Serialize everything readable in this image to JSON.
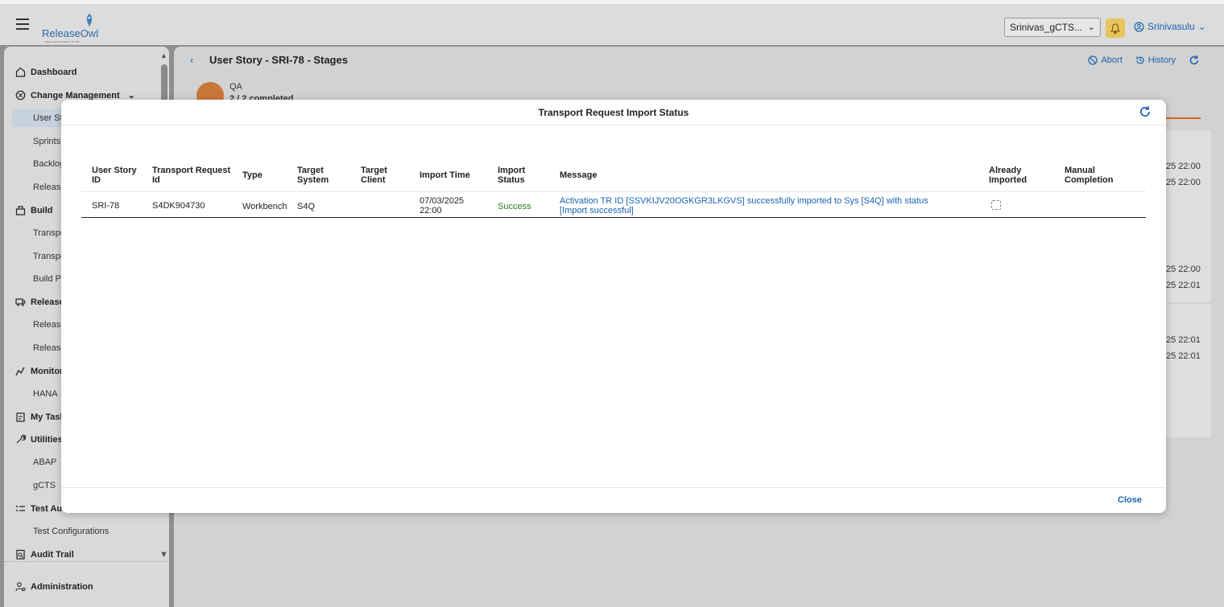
{
  "shell": {
    "logo_text": "ReleaseOwl",
    "logo_tagline": "Native DevOps Platform for SAP",
    "project": "Srinivas_gCTS...",
    "user": "Srinivasulu"
  },
  "sidebar": {
    "items": [
      {
        "label": "Dashboard",
        "icon": "home-icon"
      },
      {
        "label": "Change Management",
        "icon": "change-management-icon"
      },
      {
        "label": "User Stories"
      },
      {
        "label": "Sprints"
      },
      {
        "label": "Backlog"
      },
      {
        "label": "Releases"
      },
      {
        "label": "Build",
        "icon": "build-icon"
      },
      {
        "label": "Transports"
      },
      {
        "label": "Transports"
      },
      {
        "label": "Build Pipelines"
      },
      {
        "label": "Release",
        "icon": "release-icon"
      },
      {
        "label": "Release"
      },
      {
        "label": "Release"
      },
      {
        "label": "Monitoring",
        "icon": "monitor-icon"
      },
      {
        "label": "HANA"
      },
      {
        "label": "My Tasks",
        "icon": "tasks-icon"
      },
      {
        "label": "Utilities",
        "icon": "utilities-icon"
      },
      {
        "label": "ABAP"
      },
      {
        "label": "gCTS"
      },
      {
        "label": "Test Automation",
        "icon": "test-icon"
      },
      {
        "label": "Test Configurations"
      },
      {
        "label": "Audit Trail",
        "icon": "audit-icon"
      },
      {
        "label": "Administration",
        "icon": "admin-icon"
      }
    ]
  },
  "page": {
    "title": "User Story - SRI-78 - Stages",
    "abort_label": "Abort",
    "history_label": "History",
    "stage_name": "QA",
    "stage_sub": "2 / 2 completed",
    "times": [
      "25 22:00",
      "25 22:00",
      "25 22:00",
      "25 22:01",
      "25 22:01",
      "25 22:01"
    ]
  },
  "modal": {
    "title": "Transport Request Import Status",
    "close_label": "Close",
    "columns": [
      "User Story ID",
      "Transport Request Id",
      "Type",
      "Target System",
      "Target Client",
      "Import Time",
      "Import Status",
      "Message",
      "Already Imported",
      "Manual Completion"
    ],
    "rows": [
      {
        "user_story_id": "SRI-78",
        "tr_id": "S4DK904730",
        "type": "Workbench",
        "target_system": "S4Q",
        "target_client": "",
        "import_time": "07/03/2025 22:00",
        "import_status": "Success",
        "message": "Activation TR ID [SSVKIJV20OGKGR3LKGVS] successfully imported to Sys [S4Q] with status [Import successful]",
        "already_imported": false,
        "manual_completion": ""
      }
    ]
  },
  "colors": {
    "link": "#1a63b3",
    "success": "#2b7a1e",
    "stage_accent": "#c9763a"
  }
}
